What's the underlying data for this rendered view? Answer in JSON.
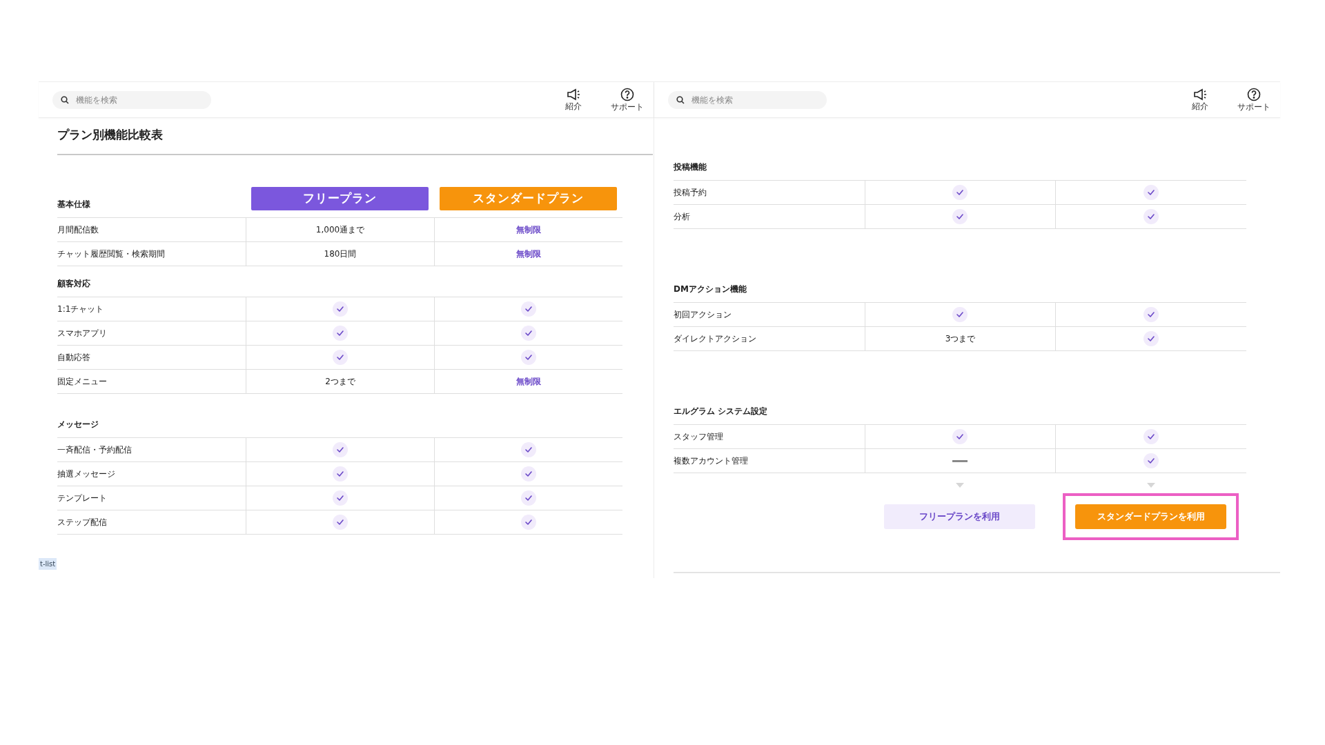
{
  "panels": [
    {
      "search": {
        "placeholder": "機能を検索"
      },
      "header_buttons": [
        {
          "label": "紹介",
          "kind": "announce"
        },
        {
          "label": "サポート",
          "kind": "help"
        }
      ],
      "title": "プラン別機能比較表",
      "plans": [
        {
          "label": "フリープラン",
          "color": "#7b57dd"
        },
        {
          "label": "スタンダードプラン",
          "color": "#f7940c"
        }
      ],
      "sections": [
        {
          "heading": "基本仕様",
          "rows": [
            {
              "label": "月間配信数",
              "cells": [
                {
                  "kind": "text",
                  "text": "1,000通まで"
                },
                {
                  "kind": "link",
                  "text": "無制限"
                }
              ]
            },
            {
              "label": "チャット履歴閲覧・検索期間",
              "cells": [
                {
                  "kind": "text",
                  "text": "180日間"
                },
                {
                  "kind": "link",
                  "text": "無制限"
                }
              ]
            }
          ]
        },
        {
          "heading": "顧客対応",
          "rows": [
            {
              "label": "1:1チャット",
              "cells": [
                {
                  "kind": "check"
                },
                {
                  "kind": "check"
                }
              ]
            },
            {
              "label": "スマホアプリ",
              "cells": [
                {
                  "kind": "check"
                },
                {
                  "kind": "check"
                }
              ]
            },
            {
              "label": "自動応答",
              "cells": [
                {
                  "kind": "check"
                },
                {
                  "kind": "check"
                }
              ]
            },
            {
              "label": "固定メニュー",
              "cells": [
                {
                  "kind": "text",
                  "text": "2つまで"
                },
                {
                  "kind": "link",
                  "text": "無制限"
                }
              ]
            }
          ]
        },
        {
          "heading": "メッセージ",
          "rows": [
            {
              "label": "一斉配信・予約配信",
              "cells": [
                {
                  "kind": "check"
                },
                {
                  "kind": "check"
                }
              ]
            },
            {
              "label": "抽選メッセージ",
              "cells": [
                {
                  "kind": "check"
                },
                {
                  "kind": "check"
                }
              ]
            },
            {
              "label": "テンプレート",
              "cells": [
                {
                  "kind": "check"
                },
                {
                  "kind": "check"
                }
              ]
            },
            {
              "label": "ステップ配信",
              "cells": [
                {
                  "kind": "check"
                },
                {
                  "kind": "check"
                }
              ]
            }
          ]
        }
      ],
      "tag": "t-list"
    },
    {
      "search": {
        "placeholder": "機能を検索"
      },
      "header_buttons": [
        {
          "label": "紹介",
          "kind": "announce"
        },
        {
          "label": "サポート",
          "kind": "help"
        }
      ],
      "sections": [
        {
          "heading": "投稿機能",
          "rows": [
            {
              "label": "投稿予約",
              "cells": [
                {
                  "kind": "check"
                },
                {
                  "kind": "check"
                }
              ]
            },
            {
              "label": "分析",
              "cells": [
                {
                  "kind": "check"
                },
                {
                  "kind": "check"
                }
              ]
            }
          ]
        },
        {
          "heading": "DMアクション機能",
          "rows": [
            {
              "label": "初回アクション",
              "cells": [
                {
                  "kind": "check"
                },
                {
                  "kind": "check"
                }
              ]
            },
            {
              "label": "ダイレクトアクション",
              "cells": [
                {
                  "kind": "text",
                  "text": "3つまで"
                },
                {
                  "kind": "check"
                }
              ]
            }
          ]
        },
        {
          "heading": "エルグラム システム設定",
          "rows": [
            {
              "label": "スタッフ管理",
              "cells": [
                {
                  "kind": "check"
                },
                {
                  "kind": "check"
                }
              ]
            },
            {
              "label": "複数アカウント管理",
              "cells": [
                {
                  "kind": "dash"
                },
                {
                  "kind": "check"
                }
              ]
            }
          ]
        }
      ],
      "actions": [
        {
          "label": "フリープランを利用",
          "kind": "secondary",
          "highlighted": false
        },
        {
          "label": "スタンダードプランを利用",
          "kind": "primary",
          "highlighted": true
        }
      ]
    }
  ]
}
